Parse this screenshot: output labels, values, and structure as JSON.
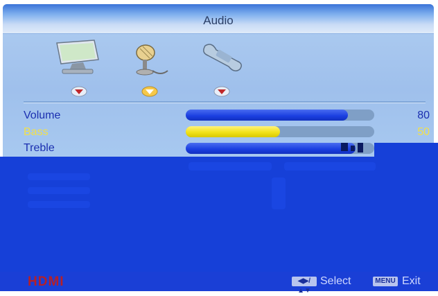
{
  "menu": {
    "title": "Audio",
    "tabs": [
      {
        "name": "picture",
        "icon": "monitor-icon",
        "active": false
      },
      {
        "name": "audio",
        "icon": "microphone-icon",
        "active": true
      },
      {
        "name": "setup",
        "icon": "wrench-icon",
        "active": false
      }
    ]
  },
  "settings": [
    {
      "label": "Volume",
      "value": "80",
      "level": 0.86,
      "active": false
    },
    {
      "label": "Bass",
      "value": "50",
      "level": 0.5,
      "active": true
    },
    {
      "label": "Treble",
      "value": "",
      "level": 0.9,
      "active": false
    }
  ],
  "footer": {
    "input": "HDMI",
    "select_key": "◀▶/▲▼",
    "select_label": "Select",
    "exit_key": "MENU",
    "exit_label": "Exit"
  },
  "colors": {
    "accent": "#1a3ee0",
    "highlight": "#f1e21a",
    "input_label": "#b4202a"
  }
}
